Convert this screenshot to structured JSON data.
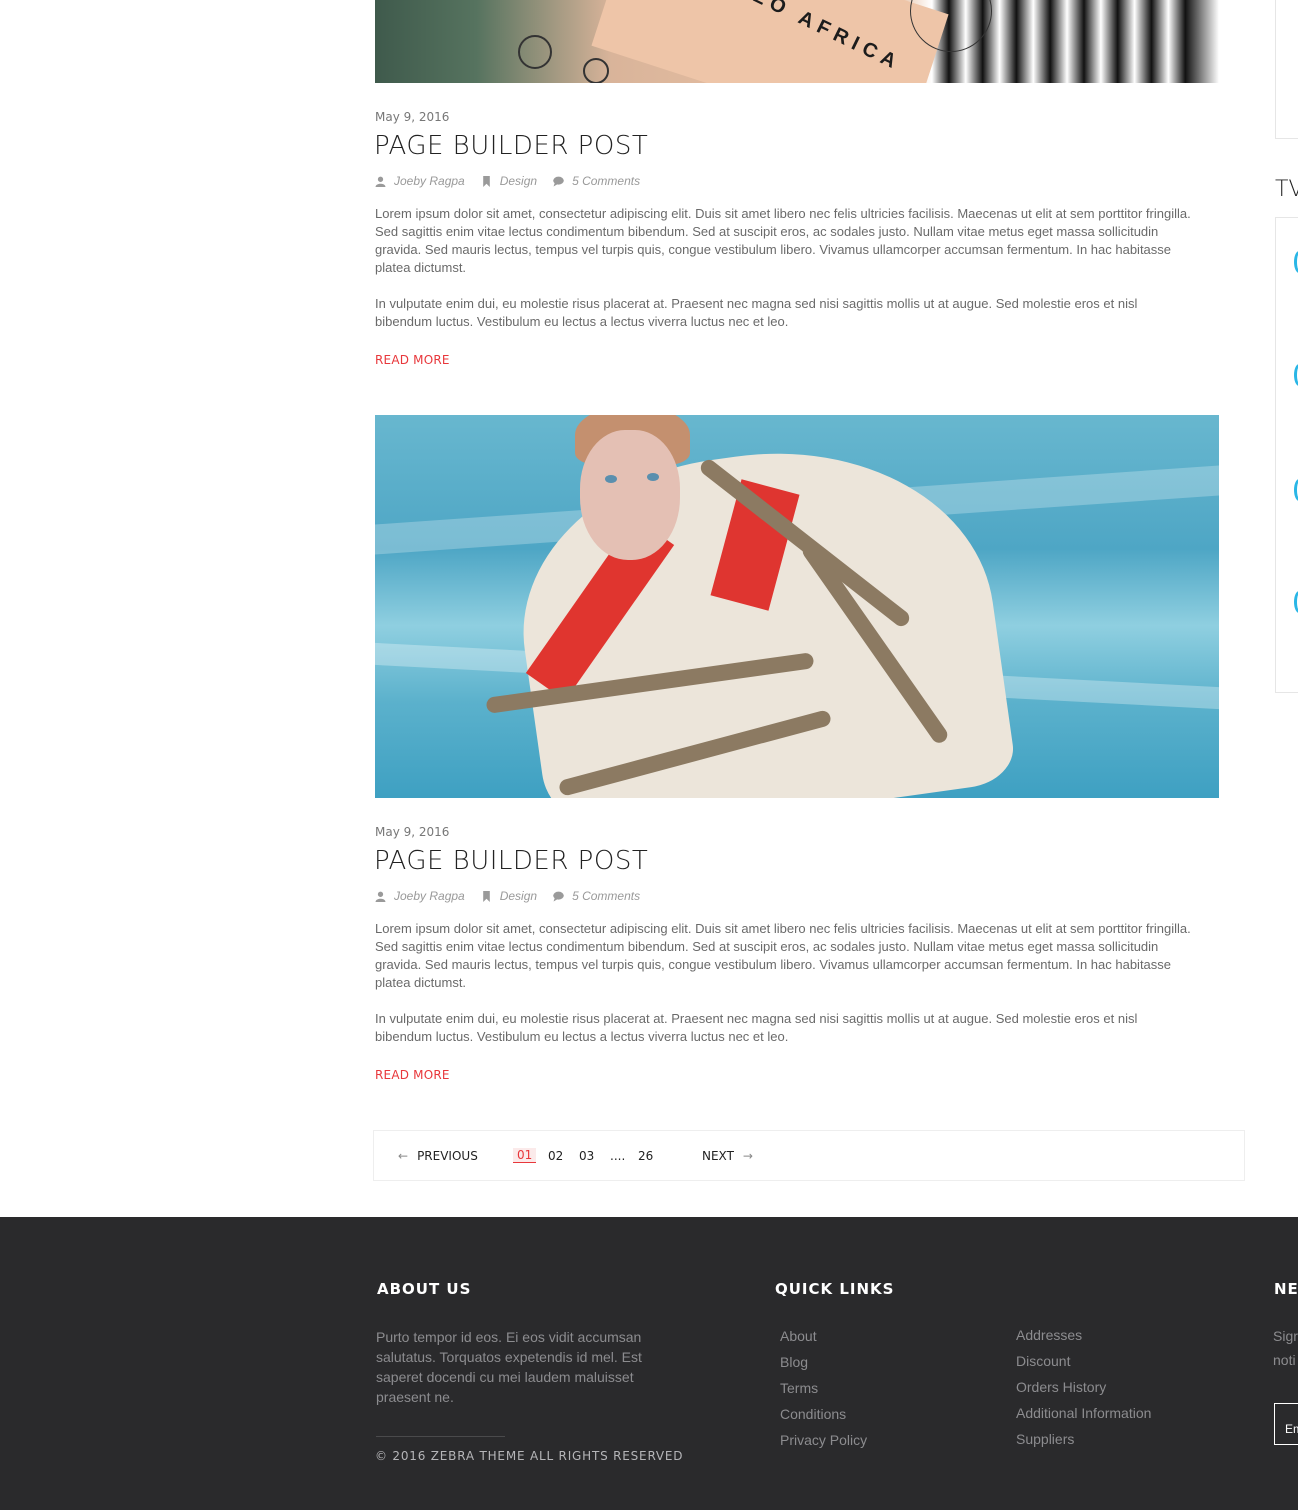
{
  "posts": [
    {
      "date": "May 9, 2016",
      "title": "PAGE BUILDER POST",
      "author": "Joeby Ragpa",
      "category": "Design",
      "comments": "5 Comments",
      "para1": "Lorem ipsum dolor sit amet, consectetur adipiscing elit. Duis sit amet libero nec felis ultricies facilisis. Maecenas ut elit at sem porttitor fringilla. Sed sagittis enim vitae lectus condimentum bibendum. Sed at suscipit eros, ac sodales justo. Nullam vitae metus eget massa sollicitudin gravida. Sed mauris lectus, tempus vel turpis quis, congue vestibulum libero. Vivamus ullamcorper accumsan fermentum. In hac habitasse platea dictumst.",
      "para2": "In vulputate enim dui, eu molestie risus placerat at. Praesent nec magna sed nisi sagittis mollis ut at augue. Sed molestie eros et nisl bibendum luctus. Vestibulum eu lectus a lectus viverra luctus nec et leo.",
      "read_more": "READ MORE"
    },
    {
      "date": "May 9, 2016",
      "title": "PAGE BUILDER POST",
      "author": "Joeby Ragpa",
      "category": "Design",
      "comments": "5 Comments",
      "para1": "Lorem ipsum dolor sit amet, consectetur adipiscing elit. Duis sit amet libero nec felis ultricies facilisis. Maecenas ut elit at sem porttitor fringilla. Sed sagittis enim vitae lectus condimentum bibendum. Sed at suscipit eros, ac sodales justo. Nullam vitae metus eget massa sollicitudin gravida. Sed mauris lectus, tempus vel turpis quis, congue vestibulum libero. Vivamus ullamcorper accumsan fermentum. In hac habitasse platea dictumst.",
      "para2": "In vulputate enim dui, eu molestie risus placerat at. Praesent nec magna sed nisi sagittis mollis ut at augue. Sed molestie eros et nisl bibendum luctus. Vestibulum eu lectus a lectus viverra luctus nec et leo.",
      "read_more": "READ MORE"
    }
  ],
  "top_image_text": "LLO AFRICA",
  "pagination": {
    "previous": "PREVIOUS",
    "next": "NEXT",
    "pages": [
      "01",
      "02",
      "03",
      "....",
      "26"
    ],
    "active": "01"
  },
  "sidebar": {
    "title_fragment": "TV"
  },
  "footer": {
    "about_heading": "ABOUT US",
    "about_text": "Purto tempor id eos. Ei eos vidit accumsan salutatus. Torquatos expetendis id mel. Est saperet docendi cu mei laudem maluisset praesent ne.",
    "copyright": "© 2016 ZEBRA THEME ALL RIGHTS RESERVED",
    "quick_links_heading": "QUICK LINKS",
    "links_col1": [
      "About",
      "Blog",
      "Terms",
      "Conditions",
      "Privacy Policy"
    ],
    "links_col2": [
      "Addresses",
      "Discount",
      "Orders History",
      "Additional Information",
      "Suppliers"
    ],
    "newsletter_heading_fragment": "NEV",
    "newsletter_text_fragment": [
      "Sigr",
      "noti"
    ],
    "email_placeholder_fragment": "Em"
  },
  "colors": {
    "accent": "#e8373b",
    "footer_bg": "#2a2a2c",
    "twitter_blue": "#29b6e6"
  }
}
